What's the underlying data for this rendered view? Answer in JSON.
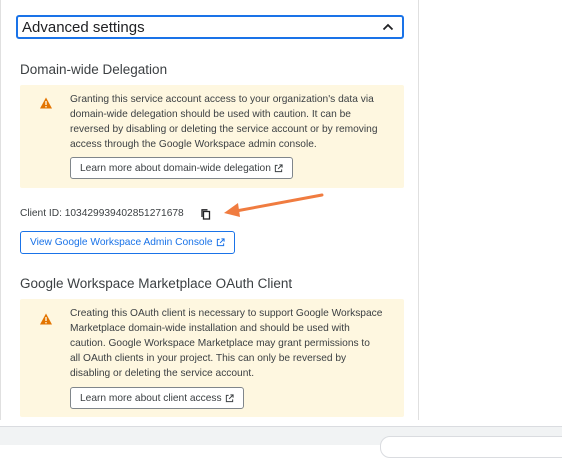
{
  "advanced": {
    "title": "Advanced settings"
  },
  "delegation": {
    "title": "Domain-wide Delegation",
    "warning_lines": [
      "Granting this service account access to your organization's data via",
      "domain-wide delegation should be used with caution. It can be",
      "reversed by disabling or deleting the service account or by removing",
      "access through the Google Workspace admin console."
    ],
    "learn_more_label": "Learn more about domain-wide delegation",
    "client_id_text": "Client ID: 103429939402851271678",
    "console_button_label": "View Google Workspace Admin Console"
  },
  "marketplace": {
    "title": "Google Workspace Marketplace OAuth Client",
    "warning_lines": [
      "Creating this OAuth client is necessary to support Google Workspace",
      "Marketplace domain-wide installation and should be used with",
      "caution. Google Workspace Marketplace may grant permissions to",
      "all OAuth clients in your project. This can only be reversed by",
      "disabling or deleting the service account."
    ],
    "learn_more_label": "Learn more about client access"
  },
  "colors": {
    "accent": "#1a73e8",
    "warning_bg": "#fef7e0",
    "warning_icon": "#e37400",
    "annotation_arrow": "#f07c40"
  },
  "icons": {
    "collapse": "chevron-up-icon",
    "warning": "warning-icon",
    "external": "open-in-new-icon",
    "copy": "copy-icon"
  }
}
